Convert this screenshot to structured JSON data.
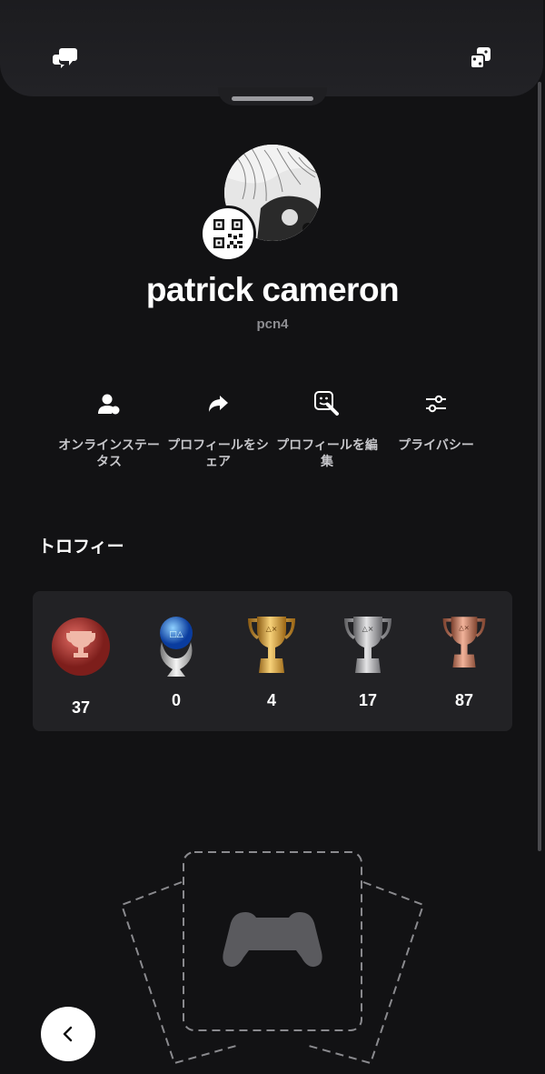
{
  "profile": {
    "display_name": "patrick cameron",
    "online_id": "pcn4"
  },
  "actions": [
    {
      "label_line1": "オンラインステー",
      "label_line2": "タス",
      "icon": "online-status-icon"
    },
    {
      "label_line1": "プロフィールをシ",
      "label_line2": "ェア",
      "icon": "share-icon"
    },
    {
      "label_line1": "プロフィールを編",
      "label_line2": "集",
      "icon": "edit-profile-icon"
    },
    {
      "label_line1": "プライバシー",
      "label_line2": "",
      "icon": "privacy-sliders-icon"
    }
  ],
  "trophies": {
    "title": "トロフィー",
    "items": [
      {
        "type": "trophy-level",
        "count": "37"
      },
      {
        "type": "platinum",
        "count": "0"
      },
      {
        "type": "gold",
        "count": "4"
      },
      {
        "type": "silver",
        "count": "17"
      },
      {
        "type": "bronze",
        "count": "87"
      }
    ]
  },
  "colors": {
    "background": "#121214",
    "card": "#222225",
    "muted_text": "#8e8e92"
  }
}
